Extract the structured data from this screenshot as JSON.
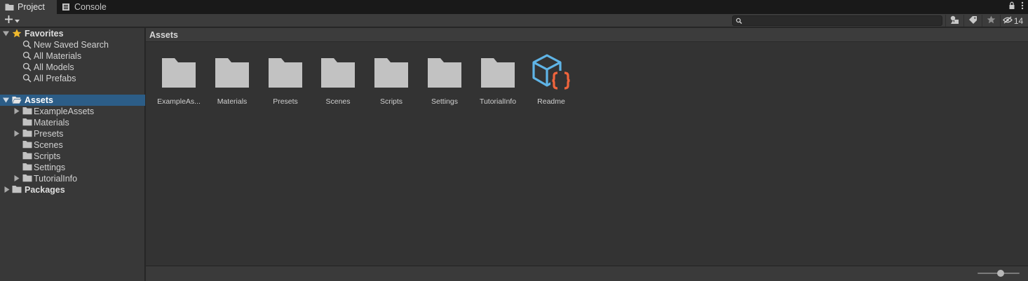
{
  "tabs": [
    {
      "label": "Project",
      "icon": "folder-icon",
      "active": true
    },
    {
      "label": "Console",
      "icon": "console-icon",
      "active": false
    }
  ],
  "toolbar": {
    "add_icon": "plus-icon",
    "hidden_count": "14"
  },
  "tree": {
    "favorites": {
      "label": "Favorites",
      "items": [
        "New Saved Search",
        "All Materials",
        "All Models",
        "All Prefabs"
      ]
    },
    "assets": {
      "label": "Assets",
      "children": [
        {
          "label": "ExampleAssets",
          "expandable": true
        },
        {
          "label": "Materials",
          "expandable": false
        },
        {
          "label": "Presets",
          "expandable": true
        },
        {
          "label": "Scenes",
          "expandable": false
        },
        {
          "label": "Scripts",
          "expandable": false
        },
        {
          "label": "Settings",
          "expandable": false
        },
        {
          "label": "TutorialInfo",
          "expandable": true
        }
      ]
    },
    "packages": {
      "label": "Packages"
    }
  },
  "main": {
    "breadcrumb": "Assets",
    "items": [
      {
        "name": "ExampleAs...",
        "type": "folder"
      },
      {
        "name": "Materials",
        "type": "folder"
      },
      {
        "name": "Presets",
        "type": "folder"
      },
      {
        "name": "Scenes",
        "type": "folder"
      },
      {
        "name": "Scripts",
        "type": "folder"
      },
      {
        "name": "Settings",
        "type": "folder"
      },
      {
        "name": "TutorialInfo",
        "type": "folder"
      },
      {
        "name": "Readme",
        "type": "readme-asset"
      }
    ]
  },
  "colors": {
    "selection": "#2c5d87",
    "favorite_star": "#f0b92c",
    "readme_cube": "#5fb4e6",
    "readme_braces": "#f0643c",
    "folder": "#c2c2c2"
  }
}
